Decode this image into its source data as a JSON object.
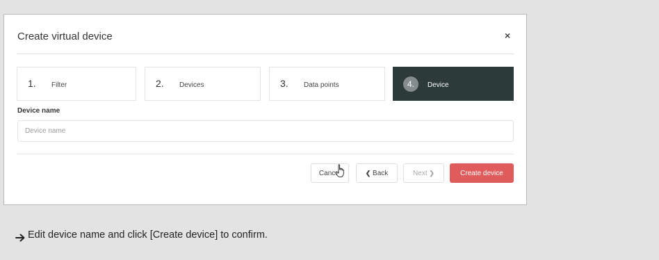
{
  "dialog": {
    "title": "Create virtual device",
    "close": "×"
  },
  "steps": [
    {
      "num": "1.",
      "label": "Filter",
      "active": false
    },
    {
      "num": "2.",
      "label": "Devices",
      "active": false
    },
    {
      "num": "3.",
      "label": "Data points",
      "active": false
    },
    {
      "num": "4.",
      "label": "Device",
      "active": true
    }
  ],
  "form": {
    "device_name_label": "Device name",
    "device_name_placeholder": "Device name",
    "device_name_value": ""
  },
  "buttons": {
    "cancel": "Cancel",
    "back": "Back",
    "next": "Next",
    "create": "Create device"
  },
  "icons": {
    "back": "chevron-left-icon",
    "next": "chevron-right-icon",
    "cursor": "hand-pointer-icon",
    "footnote_arrow": "arrow-right-icon"
  },
  "colors": {
    "active_step": "#2d3a3a",
    "primary": "#e05b5b",
    "background": "#e2e3e2"
  },
  "footnote": {
    "text": "Edit device name and click [Create device] to confirm."
  }
}
